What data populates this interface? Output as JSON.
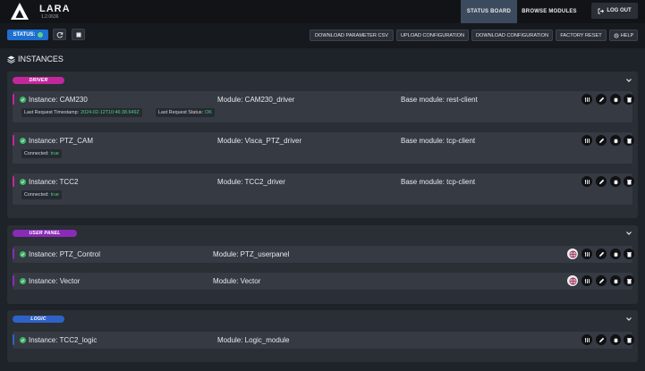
{
  "app": {
    "brand": "LARA",
    "version": "1.2.0636"
  },
  "nav": {
    "status_board": "STATUS BOARD",
    "browse_modules": "BROWSE MODULES",
    "logout": "LOG OUT"
  },
  "toolbar": {
    "status_label": "STATUS:",
    "buttons": [
      "DOWNLOAD PARAMETER CSV",
      "UPLOAD CONFIGURATION",
      "DOWNLOAD CONFIGURATION",
      "FACTORY RESET",
      "HELP"
    ]
  },
  "instances_title": "INSTANCES",
  "colors": {
    "driver": "#c2279c",
    "user_panel": "#8a2bb8",
    "logic": "#2d63c8",
    "ok_green": "#3cb567"
  },
  "groups": [
    {
      "tag": "DRIVER",
      "rows": [
        {
          "name": "Instance: CAM230",
          "module": "Module: CAM230_driver",
          "base": "Base module: rest-client",
          "details": [
            {
              "label": "Last Request Timestamp:",
              "value": "2024-02-12T10:46:38.649Z"
            },
            {
              "label": "Last Request Status:",
              "value": "OK"
            }
          ]
        },
        {
          "name": "Instance: PTZ_CAM",
          "module": "Module: Visca_PTZ_driver",
          "base": "Base module: tcp-client",
          "details": [
            {
              "label": "Connected:",
              "value": "true"
            }
          ]
        },
        {
          "name": "Instance: TCC2",
          "module": "Module: TCC2_driver",
          "base": "Base module: tcp-client",
          "details": [
            {
              "label": "Connected:",
              "value": "true"
            }
          ]
        }
      ]
    },
    {
      "tag": "USER PANEL",
      "rows": [
        {
          "name": "Instance: PTZ_Control",
          "module": "Module: PTZ_userpanel"
        },
        {
          "name": "Instance: Vector",
          "module": "Module: Vector"
        }
      ]
    },
    {
      "tag": "LOGIC",
      "rows": [
        {
          "name": "Instance: TCC2_logic",
          "module": "Module: Logic_module"
        }
      ]
    }
  ]
}
